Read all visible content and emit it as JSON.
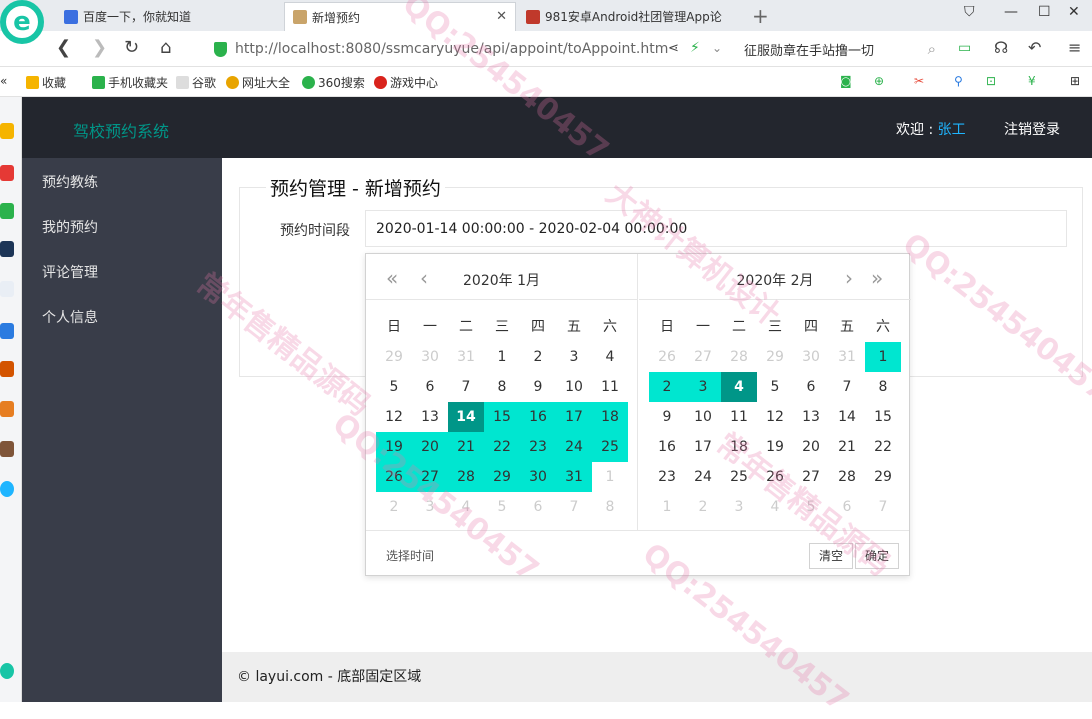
{
  "browser": {
    "tabs": [
      {
        "label": "百度一下，你就知道",
        "active": false
      },
      {
        "label": "新增预约",
        "active": true
      },
      {
        "label": "981安卓Android社团管理App论",
        "active": false
      }
    ],
    "url": "http://localhost:8080/ssmcaryuyue/api/appoint/toAppoint.htm",
    "search_text": "征服勋章在手站撸一切",
    "bookmarks": [
      "收藏",
      "手机收藏夹",
      "谷歌",
      "网址大全",
      "360搜索",
      "游戏中心"
    ],
    "colors": {
      "logo": "#18c5a6",
      "secure": "#2bb24c"
    }
  },
  "app": {
    "brand": "驾校预约系统",
    "welcome_prefix": "欢迎 : ",
    "user": "张工",
    "logout": "注销登录",
    "menu": [
      "预约教练",
      "我的预约",
      "评论管理",
      "个人信息"
    ],
    "colors": {
      "header": "#23262e",
      "sidebar": "#393d49",
      "brand": "#009688",
      "user": "#1fb5ff"
    }
  },
  "form": {
    "legend": "预约管理 - 新增预约",
    "label": "预约时间段",
    "value": "2020-01-14 00:00:00 - 2020-02-04 00:00:00"
  },
  "picker": {
    "weekdays": [
      "日",
      "一",
      "二",
      "三",
      "四",
      "五",
      "六"
    ],
    "left_title": "2020年  1月",
    "right_title": "2020年  2月",
    "left_weeks": [
      [
        "29",
        "30",
        "31",
        "1",
        "2",
        "3",
        "4"
      ],
      [
        "5",
        "6",
        "7",
        "8",
        "9",
        "10",
        "11"
      ],
      [
        "12",
        "13",
        "14",
        "15",
        "16",
        "17",
        "18"
      ],
      [
        "19",
        "20",
        "21",
        "22",
        "23",
        "24",
        "25"
      ],
      [
        "26",
        "27",
        "28",
        "29",
        "30",
        "31",
        "1"
      ],
      [
        "2",
        "3",
        "4",
        "5",
        "6",
        "7",
        "8"
      ]
    ],
    "right_weeks": [
      [
        "26",
        "27",
        "28",
        "29",
        "30",
        "31",
        "1"
      ],
      [
        "2",
        "3",
        "4",
        "5",
        "6",
        "7",
        "8"
      ],
      [
        "9",
        "10",
        "11",
        "12",
        "13",
        "14",
        "15"
      ],
      [
        "16",
        "17",
        "18",
        "19",
        "20",
        "21",
        "22"
      ],
      [
        "23",
        "24",
        "25",
        "26",
        "27",
        "28",
        "29"
      ],
      [
        "1",
        "2",
        "3",
        "4",
        "5",
        "6",
        "7"
      ]
    ],
    "range_start": "2020-01-14",
    "range_end": "2020-02-04",
    "footer_label": "选择时间",
    "clear": "清空",
    "confirm": "确定",
    "colors": {
      "range": "#00e6d0",
      "selected": "#009688"
    }
  },
  "footer": {
    "text": "© layui.com - 底部固定区域"
  },
  "watermarks": [
    "大神计算机设计",
    "QQ:254540457",
    "常年售精品源码"
  ]
}
